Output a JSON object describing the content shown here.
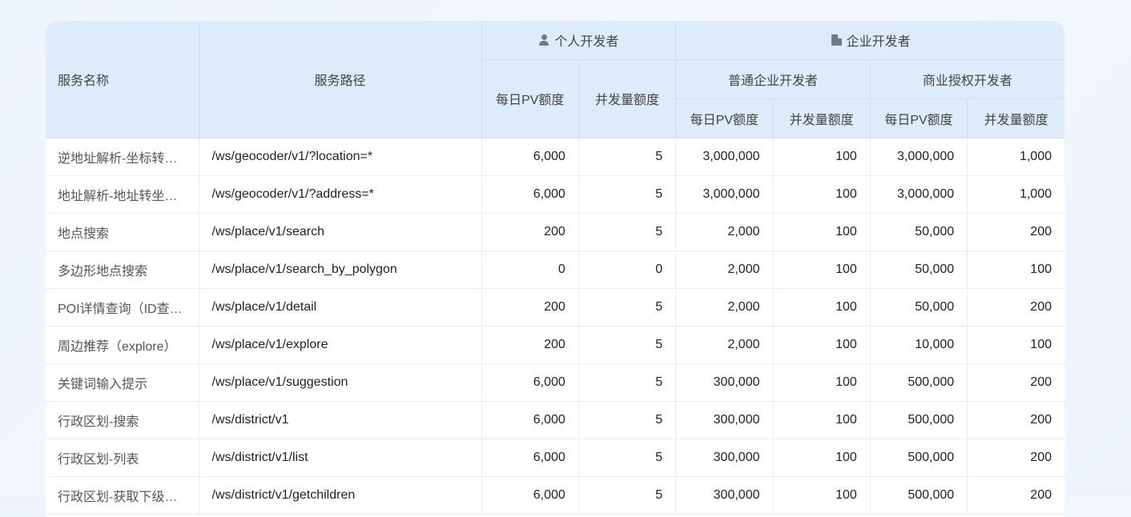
{
  "headers": {
    "service_name": "服务名称",
    "service_path": "服务路径",
    "personal_dev": "个人开发者",
    "enterprise_dev": "企业开发者",
    "normal_enterprise": "普通企业开发者",
    "commercial_auth": "商业授权开发者",
    "daily_pv": "每日PV额度",
    "concurrency": "并发量额度"
  },
  "icons": {
    "personal": "user-icon",
    "enterprise": "building-icon"
  },
  "colors": {
    "header_bg": "#deebfb",
    "page_bg": "#eef4fd"
  },
  "rows": [
    {
      "name": "逆地址解析-坐标转…",
      "path": "/ws/geocoder/v1/?location=*",
      "p_pv": "6,000",
      "p_cc": "5",
      "n_pv": "3,000,000",
      "n_cc": "100",
      "c_pv": "3,000,000",
      "c_cc": "1,000"
    },
    {
      "name": "地址解析-地址转坐…",
      "path": "/ws/geocoder/v1/?address=*",
      "p_pv": "6,000",
      "p_cc": "5",
      "n_pv": "3,000,000",
      "n_cc": "100",
      "c_pv": "3,000,000",
      "c_cc": "1,000"
    },
    {
      "name": "地点搜索",
      "path": "/ws/place/v1/search",
      "p_pv": "200",
      "p_cc": "5",
      "n_pv": "2,000",
      "n_cc": "100",
      "c_pv": "50,000",
      "c_cc": "200"
    },
    {
      "name": "多边形地点搜索",
      "path": "/ws/place/v1/search_by_polygon",
      "p_pv": "0",
      "p_cc": "0",
      "n_pv": "2,000",
      "n_cc": "100",
      "c_pv": "50,000",
      "c_cc": "100"
    },
    {
      "name": "POI详情查询（ID查…",
      "path": "/ws/place/v1/detail",
      "p_pv": "200",
      "p_cc": "5",
      "n_pv": "2,000",
      "n_cc": "100",
      "c_pv": "50,000",
      "c_cc": "200"
    },
    {
      "name": "周边推荐（explore）",
      "path": "/ws/place/v1/explore",
      "p_pv": "200",
      "p_cc": "5",
      "n_pv": "2,000",
      "n_cc": "100",
      "c_pv": "10,000",
      "c_cc": "100"
    },
    {
      "name": "关键词输入提示",
      "path": "/ws/place/v1/suggestion",
      "p_pv": "6,000",
      "p_cc": "5",
      "n_pv": "300,000",
      "n_cc": "100",
      "c_pv": "500,000",
      "c_cc": "200"
    },
    {
      "name": "行政区划-搜索",
      "path": "/ws/district/v1",
      "p_pv": "6,000",
      "p_cc": "5",
      "n_pv": "300,000",
      "n_cc": "100",
      "c_pv": "500,000",
      "c_cc": "200"
    },
    {
      "name": "行政区划-列表",
      "path": "/ws/district/v1/list",
      "p_pv": "6,000",
      "p_cc": "5",
      "n_pv": "300,000",
      "n_cc": "100",
      "c_pv": "500,000",
      "c_cc": "200"
    },
    {
      "name": "行政区划-获取下级…",
      "path": "/ws/district/v1/getchildren",
      "p_pv": "6,000",
      "p_cc": "5",
      "n_pv": "300,000",
      "n_cc": "100",
      "c_pv": "500,000",
      "c_cc": "200"
    }
  ]
}
